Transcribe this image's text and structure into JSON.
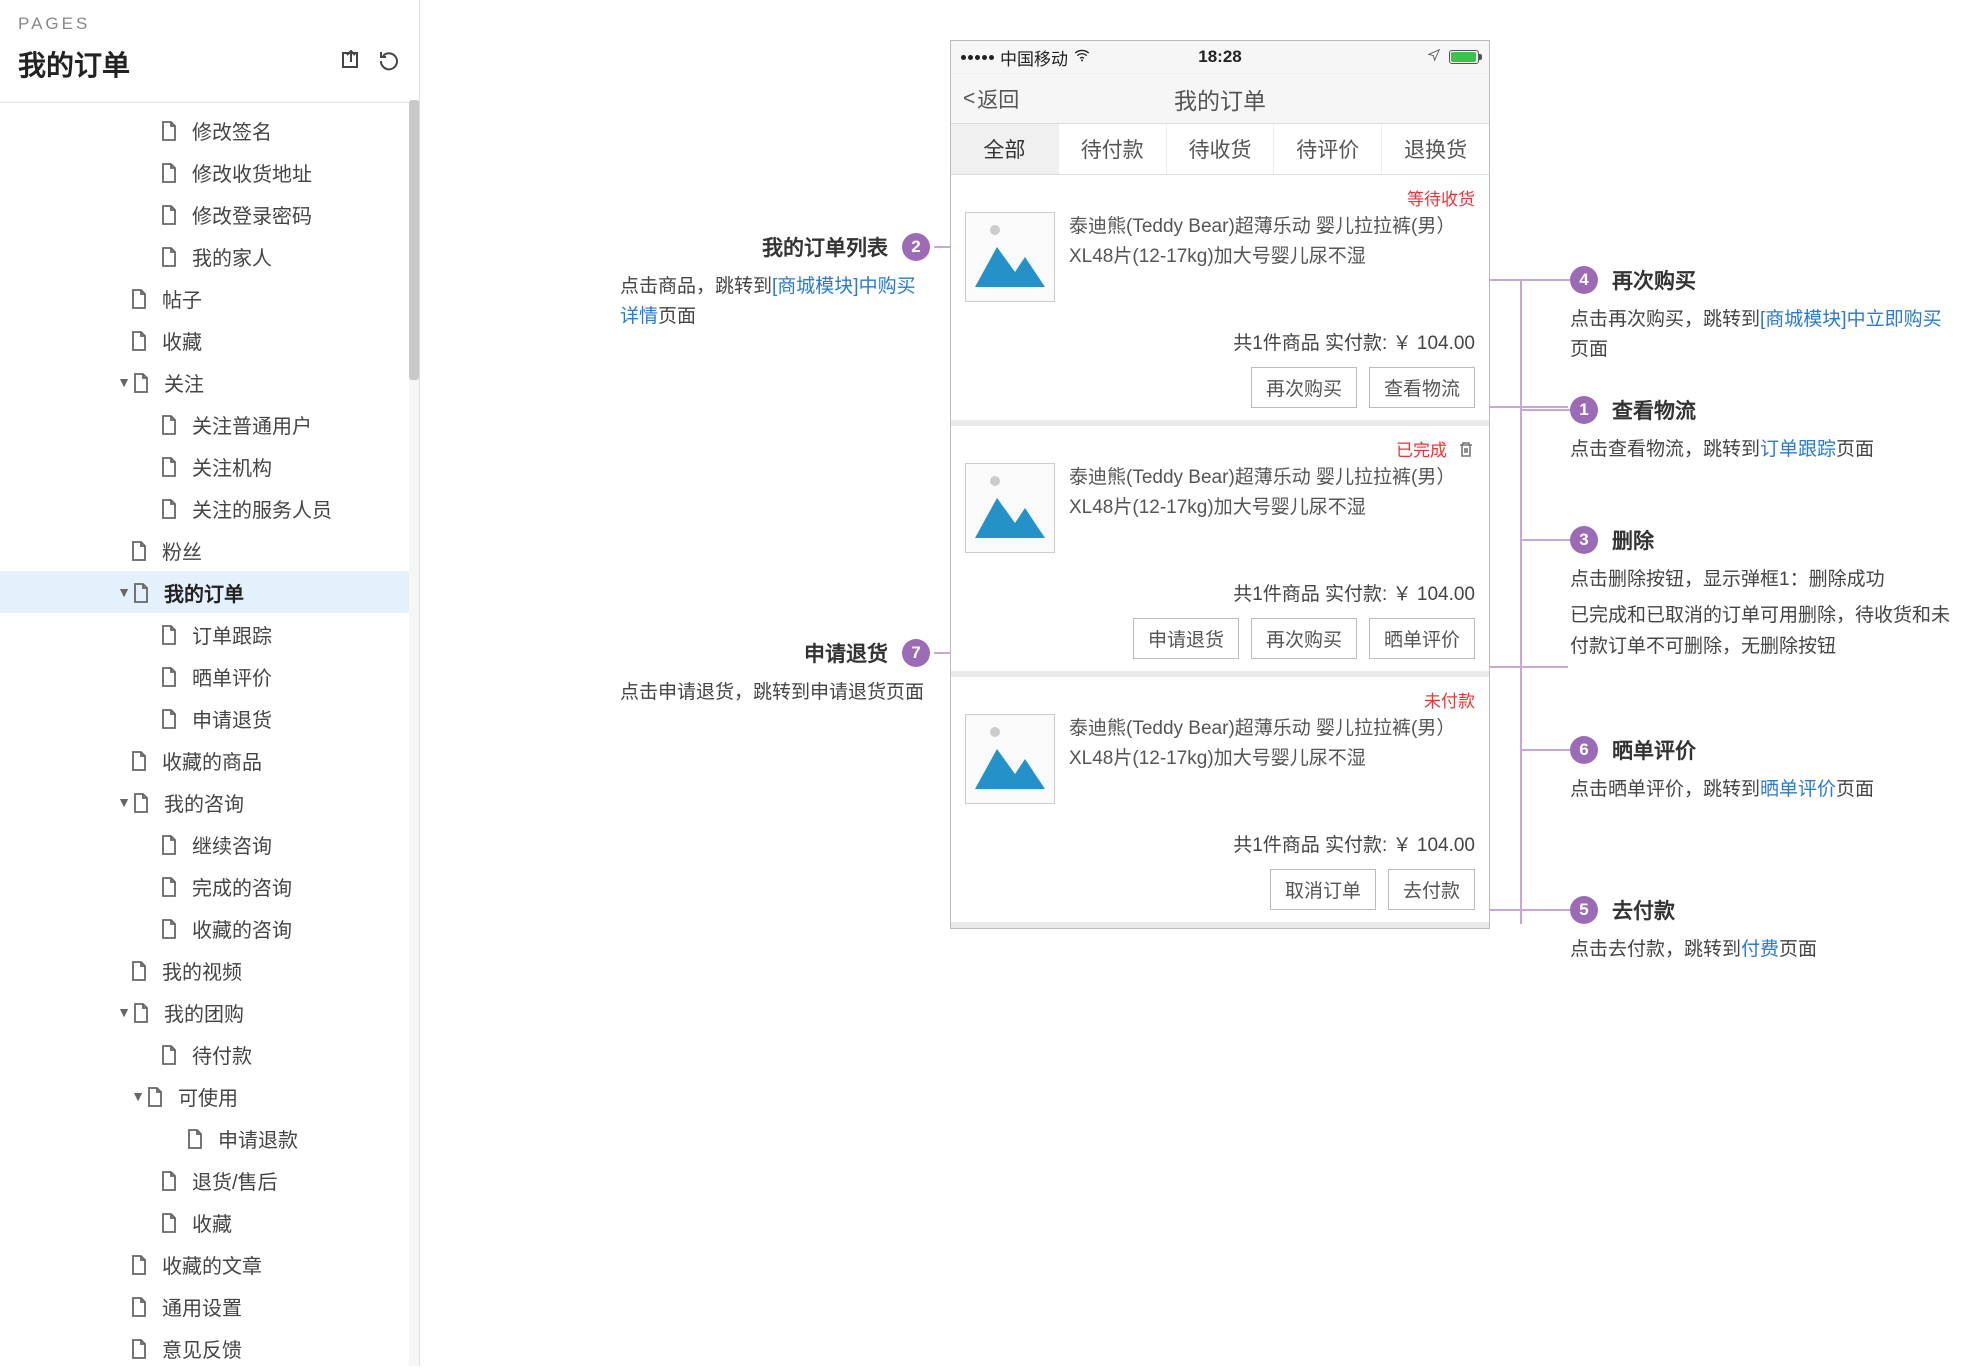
{
  "sidebar": {
    "header": "PAGES",
    "title": "我的订单",
    "items": [
      {
        "label": "修改签名",
        "indent": "ind-3",
        "sel": false,
        "arrow": ""
      },
      {
        "label": "修改收货地址",
        "indent": "ind-3",
        "sel": false,
        "arrow": ""
      },
      {
        "label": "修改登录密码",
        "indent": "ind-3",
        "sel": false,
        "arrow": ""
      },
      {
        "label": "我的家人",
        "indent": "ind-3",
        "sel": false,
        "arrow": ""
      },
      {
        "label": "帖子",
        "indent": "ind-2",
        "sel": false,
        "arrow": ""
      },
      {
        "label": "收藏",
        "indent": "ind-2",
        "sel": false,
        "arrow": ""
      },
      {
        "label": "关注",
        "indent": "ind-2a",
        "sel": false,
        "arrow": "▼"
      },
      {
        "label": "关注普通用户",
        "indent": "ind-3",
        "sel": false,
        "arrow": ""
      },
      {
        "label": "关注机构",
        "indent": "ind-3",
        "sel": false,
        "arrow": ""
      },
      {
        "label": "关注的服务人员",
        "indent": "ind-3",
        "sel": false,
        "arrow": ""
      },
      {
        "label": "粉丝",
        "indent": "ind-2",
        "sel": false,
        "arrow": ""
      },
      {
        "label": "我的订单",
        "indent": "ind-2a",
        "sel": true,
        "arrow": "▼"
      },
      {
        "label": "订单跟踪",
        "indent": "ind-3",
        "sel": false,
        "arrow": ""
      },
      {
        "label": "晒单评价",
        "indent": "ind-3",
        "sel": false,
        "arrow": ""
      },
      {
        "label": "申请退货",
        "indent": "ind-3",
        "sel": false,
        "arrow": ""
      },
      {
        "label": "收藏的商品",
        "indent": "ind-2",
        "sel": false,
        "arrow": ""
      },
      {
        "label": "我的咨询",
        "indent": "ind-2a",
        "sel": false,
        "arrow": "▼"
      },
      {
        "label": "继续咨询",
        "indent": "ind-3",
        "sel": false,
        "arrow": ""
      },
      {
        "label": "完成的咨询",
        "indent": "ind-3",
        "sel": false,
        "arrow": ""
      },
      {
        "label": "收藏的咨询",
        "indent": "ind-3",
        "sel": false,
        "arrow": ""
      },
      {
        "label": "我的视频",
        "indent": "ind-2",
        "sel": false,
        "arrow": ""
      },
      {
        "label": "我的团购",
        "indent": "ind-2a",
        "sel": false,
        "arrow": "▼"
      },
      {
        "label": "待付款",
        "indent": "ind-3",
        "sel": false,
        "arrow": ""
      },
      {
        "label": "可使用",
        "indent": "ind-2b",
        "sel": false,
        "arrow": "▼"
      },
      {
        "label": "申请退款",
        "indent": "ind-3b",
        "sel": false,
        "arrow": ""
      },
      {
        "label": "退货/售后",
        "indent": "ind-3",
        "sel": false,
        "arrow": ""
      },
      {
        "label": "收藏",
        "indent": "ind-3",
        "sel": false,
        "arrow": ""
      },
      {
        "label": "收藏的文章",
        "indent": "ind-2",
        "sel": false,
        "arrow": ""
      },
      {
        "label": "通用设置",
        "indent": "ind-2",
        "sel": false,
        "arrow": ""
      },
      {
        "label": "意见反馈",
        "indent": "ind-2",
        "sel": false,
        "arrow": ""
      }
    ]
  },
  "phone": {
    "carrier": "中国移动",
    "time": "18:28",
    "back": "返回",
    "title": "我的订单",
    "tabs": [
      "全部",
      "待付款",
      "待收货",
      "待评价",
      "退换货"
    ],
    "active_tab": 0,
    "orders": [
      {
        "status_class": "status-wait",
        "status": "等待收货",
        "delete": false,
        "name": "泰迪熊(Teddy Bear)超薄乐动 婴儿拉拉裤(男）XL48片(12-17kg)加大号婴儿尿不湿",
        "summary": "共1件商品 实付款: ￥ 104.00",
        "actions": [
          "再次购买",
          "查看物流"
        ]
      },
      {
        "status_class": "status-done",
        "status": "已完成",
        "delete": true,
        "name": "泰迪熊(Teddy Bear)超薄乐动 婴儿拉拉裤(男）XL48片(12-17kg)加大号婴儿尿不湿",
        "summary": "共1件商品 实付款: ￥ 104.00",
        "actions": [
          "申请退货",
          "再次购买",
          "晒单评价"
        ]
      },
      {
        "status_class": "status-unpaid",
        "status": "未付款",
        "delete": false,
        "name": "泰迪熊(Teddy Bear)超薄乐动 婴儿拉拉裤(男）XL48片(12-17kg)加大号婴儿尿不湿",
        "summary": "共1件商品 实付款: ￥ 104.00",
        "actions": [
          "取消订单",
          "去付款"
        ]
      }
    ]
  },
  "ann": {
    "a2": {
      "num": "2",
      "title": "我的订单列表",
      "body_pre": "点击商品，跳转到",
      "link": "[商城模块]中购买详情",
      "body_post": "页面"
    },
    "a7": {
      "num": "7",
      "title": "申请退货",
      "body": "点击申请退货，跳转到申请退货页面"
    },
    "a4": {
      "num": "4",
      "title": "再次购买",
      "body_pre": "点击再次购买，跳转到",
      "link": "[商城模块]中立即购买",
      "body_post": "页面"
    },
    "a1": {
      "num": "1",
      "title": "查看物流",
      "body_pre": "点击查看物流，跳转到",
      "link": "订单跟踪",
      "body_post": "页面"
    },
    "a3": {
      "num": "3",
      "title": "删除",
      "body1": "点击删除按钮，显示弹框1：删除成功",
      "body2": "已完成和已取消的订单可用删除，待收货和未付款订单不可删除，无删除按钮"
    },
    "a6": {
      "num": "6",
      "title": "晒单评价",
      "body_pre": "点击晒单评价，跳转到",
      "link": "晒单评价",
      "body_post": "页面"
    },
    "a5": {
      "num": "5",
      "title": "去付款",
      "body_pre": "点击去付款，跳转到",
      "link": "付费",
      "body_post": "页面"
    }
  }
}
